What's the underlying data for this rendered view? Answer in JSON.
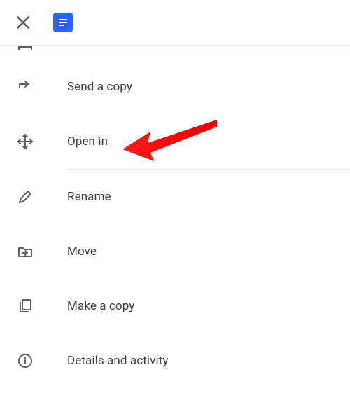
{
  "header": {
    "close": "close",
    "app": "docs"
  },
  "menu": {
    "items": [
      {
        "label": "Send a copy"
      },
      {
        "label": "Open in"
      },
      {
        "label": "Rename"
      },
      {
        "label": "Move"
      },
      {
        "label": "Make a copy"
      },
      {
        "label": "Details and activity"
      }
    ]
  },
  "annotation": {
    "target": "open-in"
  }
}
